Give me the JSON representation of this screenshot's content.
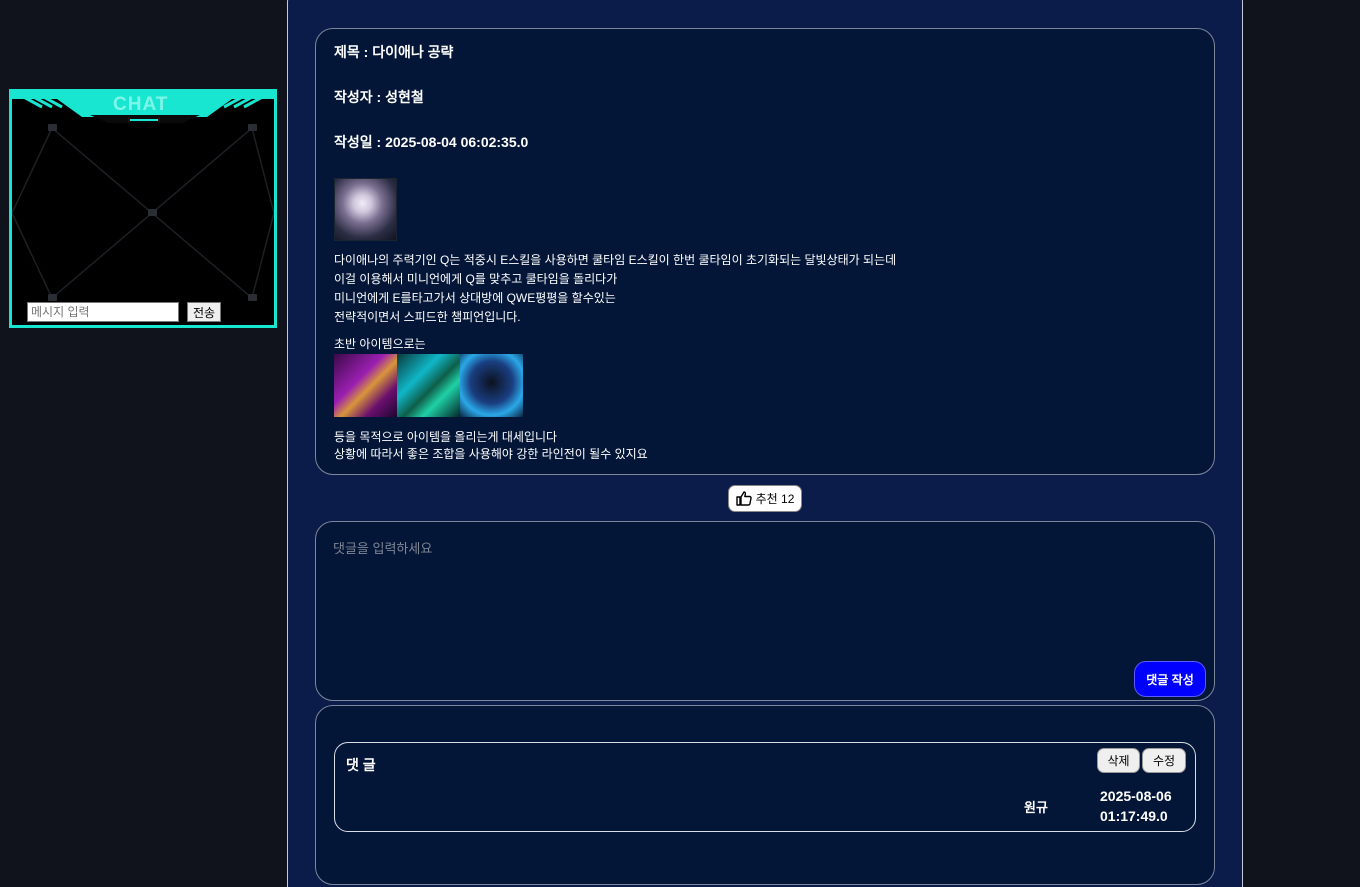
{
  "chat": {
    "logo_text": "CHAT",
    "input_placeholder": "메시지 입력",
    "send_label": "전송"
  },
  "post": {
    "title_line": "제목 : 다이애나 공략",
    "author_line": "작성자 : 성현철",
    "date_line": "작성일 : 2025-08-04 06:02:35.0",
    "body_lines": [
      "다이애나의 주력기인 Q는 적중시 E스킬을 사용하면 쿨타임 E스킬이 한번 쿨타임이 초기화되는 달빛상태가 되는데",
      "이걸 이용해서 미니언에게 Q를 맞추고 쿨타임을 돌리다가",
      "미니언에게 E를타고가서 상대방에 QWE평평을 할수있는",
      "전략적이면서 스피드한 챔피언입니다."
    ],
    "items_label": "초반 아이템으로는",
    "closing_lines": [
      "등을 목적으로 아이템을 올리는게 대세입니다",
      "상황에 따라서 좋은 조합을 사용해야 강한 라인전이 될수 있지요"
    ]
  },
  "like": {
    "label": "추천 12",
    "icon": "thumbs-up-icon"
  },
  "comment_form": {
    "placeholder": "댓글을 입력하세요",
    "submit_label": "댓글 작성"
  },
  "comments": [
    {
      "heading": "댓 글",
      "author": "원규",
      "date_line1": "2025-08-06",
      "date_line2": "01:17:49.0",
      "delete_label": "삭제",
      "edit_label": "수정"
    }
  ],
  "colors": {
    "page_bg": "#10131b",
    "panel_bg": "#0b1b4a",
    "box_bg": "#041638",
    "chat_accent": "#18e6d0",
    "submit_bg": "#0000ff"
  }
}
